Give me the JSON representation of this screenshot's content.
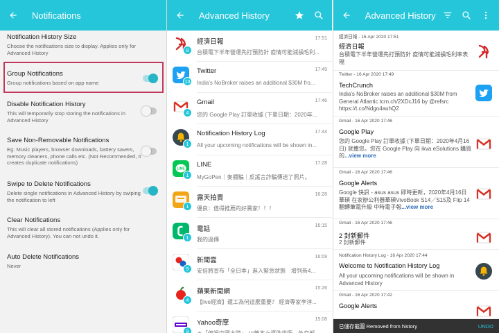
{
  "settings": {
    "title": "Notifications",
    "items": [
      {
        "title": "Notification History Size",
        "subtitle": "Choose the notifications size to display. Applies only for Advanced History"
      },
      {
        "title": "Group Notifications",
        "subtitle": "Group notifications based on app name",
        "toggle": "on"
      },
      {
        "title": "Disable Notification History",
        "subtitle": "This will temporarily stop storing the notifications in Advanced History",
        "toggle": "off"
      },
      {
        "title": "Save Non-Removable Notifications",
        "subtitle": "Eg: Music players, browser downloads, battery savers, memory cleaners, phone calls etc. (Not Recommended, it creates duplicate notifications)",
        "toggle": "off"
      },
      {
        "title": "Swipe to Delete Notifications",
        "subtitle": "Delete single notifications in Advanced History by swiping the notification to left",
        "toggle": "on"
      },
      {
        "title": "Clear Notifications",
        "subtitle": "This will clear all stored notifications (Applies only for Advanced History). You can not undo it."
      },
      {
        "title": "Auto Delete Notifications",
        "subtitle": "Never"
      }
    ]
  },
  "history": {
    "title": "Advanced History",
    "rows": [
      {
        "app": "經濟日報",
        "text": "台積電下半年營運先打預防針 疫情可能減損毛利...",
        "time": "17:51",
        "count": "8",
        "icon": "economic-daily-icon",
        "color": "#d12b2b"
      },
      {
        "app": "Twitter",
        "text": "India's NoBroker raises an additional $30M fro...",
        "time": "17:49",
        "count": "13",
        "icon": "twitter-icon",
        "color": "#1da1f2"
      },
      {
        "app": "Gmail",
        "text": "您的 Google Play 訂單收據 (下單日期：2020年...",
        "time": "17:46",
        "count": "4",
        "icon": "gmail-icon",
        "color": "#d93025"
      },
      {
        "app": "Notification History Log",
        "text": "All your upcoming notifications will be shown in...",
        "time": "17:44",
        "count": "1",
        "icon": "bell-icon",
        "color": "#f4b400"
      },
      {
        "app": "LINE",
        "text": "MyGoPen｜麥擱騙｜反謠言詐騙傳送了照片。",
        "time": "17:28",
        "count": "1",
        "icon": "line-icon",
        "color": "#06c755"
      },
      {
        "app": "露天拍賣",
        "text": "優良：值得推薦的好賣家！！！",
        "time": "16:28",
        "count": "1",
        "icon": "ruten-icon",
        "color": "#f2a516"
      },
      {
        "app": "電話",
        "text": "我的過傳",
        "time": "16:15",
        "count": "1",
        "icon": "phone-icon",
        "color": "#00b86b"
      },
      {
        "app": "新聞雲",
        "text": "安倍將宣布「全日本」進入緊急狀態　增列新4...",
        "time": "16:09",
        "count": "9",
        "icon": "ettoday-icon",
        "color": "#1a62c4"
      },
      {
        "app": "蘋果新聞網",
        "text": "【live經濟】還工為何這麼重要？ 經濟專家李淳...",
        "time": "15:26",
        "count": "4",
        "icon": "apple-daily-icon",
        "color": "#e8221c"
      },
      {
        "app": "Yahoo奇摩",
        "text": "＊「偏袒中國大陸」 川普不止資助世衛　外交部...",
        "time": "15:08",
        "count": "9",
        "icon": "yahoo-icon",
        "color": "#5f01d1"
      }
    ]
  },
  "detail": {
    "title": "Advanced History",
    "entries": [
      {
        "meta": "經濟日報 - 16 Apr 2020 17:51",
        "title": "經濟日報",
        "body": "台積電下半年營運先打預防針 疫情可能減損毛利率表現",
        "more": "",
        "icon": "economic-daily-icon"
      },
      {
        "meta": "Twitter - 16 Apr 2020 17:49",
        "title": "TechCrunch",
        "body": "India's NoBroker raises an additional $30M from General Atlantic tcrn.ch/2XDcJ16 by @refsrc https://t.co/Ndgo4auhQ2",
        "more": "",
        "icon": "twitter-icon"
      },
      {
        "meta": "Gmail - 16 Apr 2020 17:46",
        "title": "Google Play",
        "body": "您的 Google Play 訂單收據 (下單日期：2020年4月16日) 就撒您。您在 Google Play 向 ikva eSolutions 購買的",
        "more": "...view more",
        "icon": "gmail-icon"
      },
      {
        "meta": "Gmail - 16 Apr 2020 17:46",
        "title": "Google Alerts",
        "body": "Google 快訊 - asus asus 即時更新，2020年4月16日 華碩 在家辦公利器華碩VivoBook S14／S15及 Flip 14翻轉筆電升級 中時電子報",
        "more": "...view more",
        "icon": "gmail-icon"
      },
      {
        "meta": "Gmail - 16 Apr 2020 17:46",
        "title": "2 封新郵件",
        "body": "2 封新郵件",
        "more": "",
        "icon": "gmail-icon"
      },
      {
        "meta": "Notification History Log - 16 Apr 2020 17:44",
        "title": "Welcome to Notification History Log",
        "body": "All your upcoming notifications will be shown in Advanced History",
        "more": "",
        "icon": "bell-icon"
      },
      {
        "meta": "Gmail - 16 Apr 2020 17:42",
        "title": "Google Alerts",
        "body": "",
        "more": "",
        "icon": "gmail-icon"
      }
    ]
  },
  "snackbar": {
    "message": "已儲存截圖 Removed from history",
    "action": "UNDO"
  },
  "colors": {
    "accent": "#26c6da",
    "highlight": "#c0395a"
  }
}
